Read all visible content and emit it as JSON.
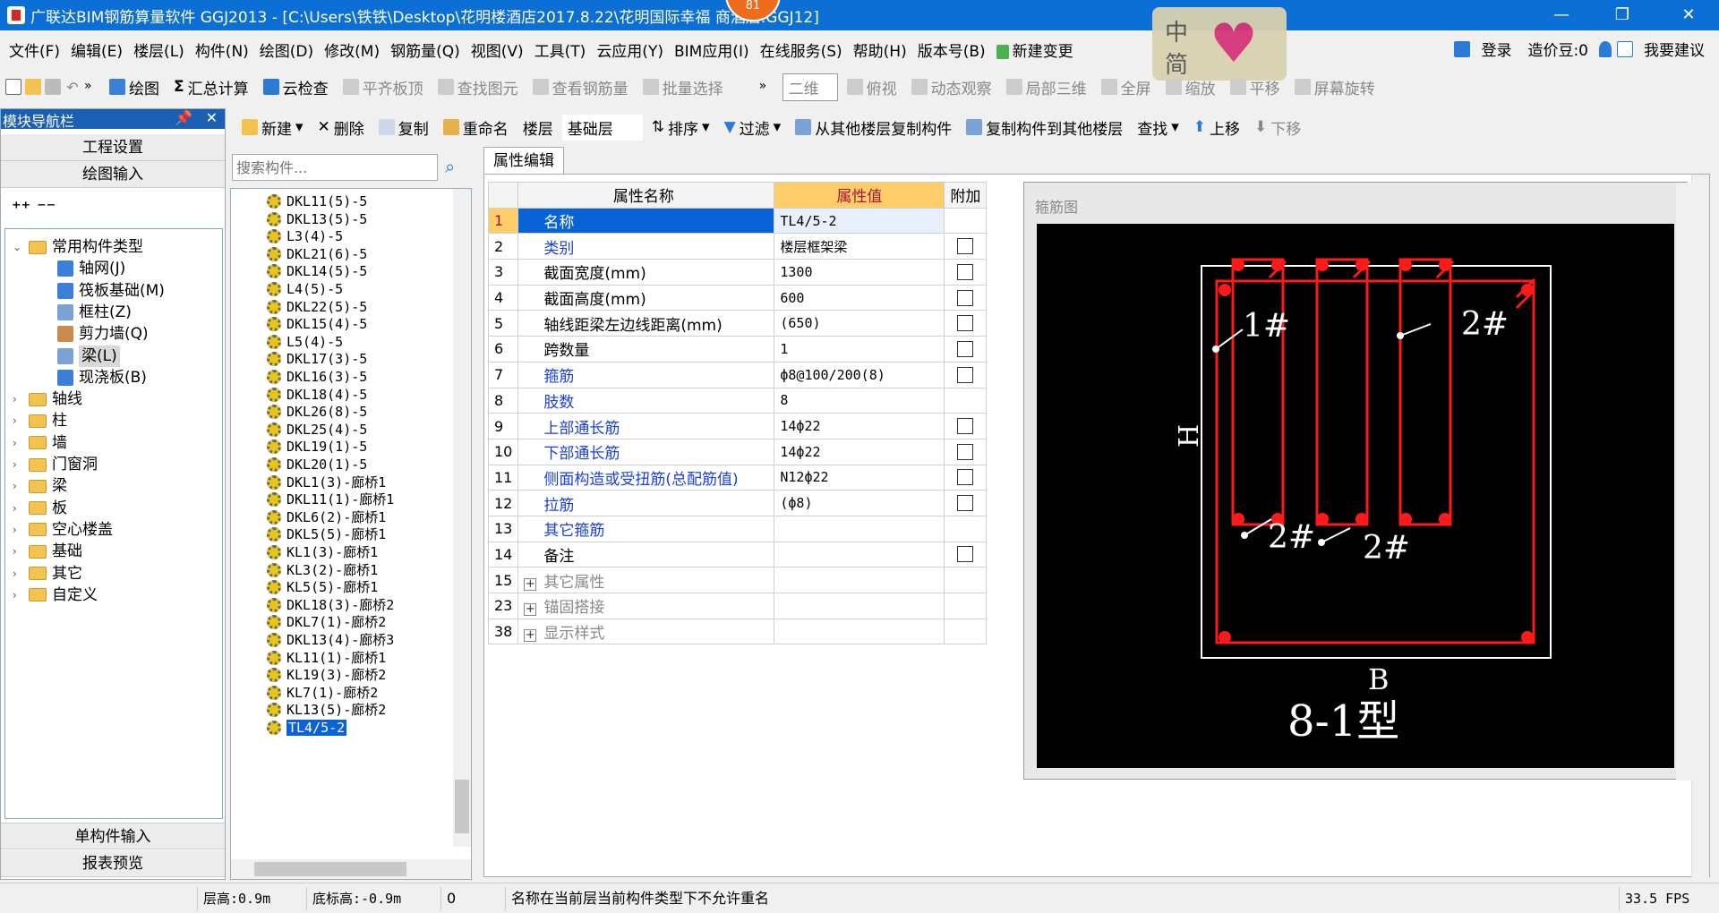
{
  "window": {
    "title": "广联达BIM钢筋算量软件 GGJ2013 - [C:\\Users\\铁铁\\Desktop\\花明楼酒店2017.8.22\\花明国际幸福 商酒店.GGJ12]",
    "badge": "81"
  },
  "menu": [
    "文件(F)",
    "编辑(E)",
    "楼层(L)",
    "构件(N)",
    "绘图(D)",
    "修改(M)",
    "钢筋量(Q)",
    "视图(V)",
    "工具(T)",
    "云应用(Y)",
    "BIM应用(I)",
    "在线服务(S)",
    "帮助(H)",
    "版本号(B)",
    "新建变更"
  ],
  "menu_right": {
    "login": "登录",
    "bean": "造价豆:0",
    "suggest": "我要建议"
  },
  "ime": {
    "zh": "中",
    "jian": "简"
  },
  "toolbar1": [
    "绘图",
    "汇总计算",
    "云检查",
    "平齐板顶",
    "查找图元",
    "查看钢筋量",
    "批量选择",
    "二维",
    "俯视",
    "动态观察",
    "局部三维",
    "全屏",
    "缩放",
    "平移",
    "屏幕旋转"
  ],
  "toolbar2": {
    "new": "新建",
    "delete": "删除",
    "copy": "复制",
    "rename": "重命名",
    "floor_label": "楼层",
    "floor_value": "基础层",
    "sort": "排序",
    "filter": "过滤",
    "copy_from": "从其他楼层复制构件",
    "copy_to": "复制构件到其他楼层",
    "find": "查找",
    "up": "上移",
    "down": "下移"
  },
  "nav": {
    "header": "模块导航栏",
    "project_settings": "工程设置",
    "drawing_input": "绘图输入",
    "single_input": "单构件输入",
    "report": "报表预览",
    "tree": [
      {
        "label": "常用构件类型",
        "level": 0,
        "expanded": true
      },
      {
        "label": "轴网(J)",
        "level": 1
      },
      {
        "label": "筏板基础(M)",
        "level": 1
      },
      {
        "label": "框柱(Z)",
        "level": 1
      },
      {
        "label": "剪力墙(Q)",
        "level": 1
      },
      {
        "label": "梁(L)",
        "level": 1,
        "selected": true
      },
      {
        "label": "现浇板(B)",
        "level": 1
      },
      {
        "label": "轴线",
        "level": 0
      },
      {
        "label": "柱",
        "level": 0
      },
      {
        "label": "墙",
        "level": 0
      },
      {
        "label": "门窗洞",
        "level": 0
      },
      {
        "label": "梁",
        "level": 0
      },
      {
        "label": "板",
        "level": 0
      },
      {
        "label": "空心楼盖",
        "level": 0
      },
      {
        "label": "基础",
        "level": 0
      },
      {
        "label": "其它",
        "level": 0
      },
      {
        "label": "自定义",
        "level": 0
      }
    ]
  },
  "search_placeholder": "搜索构件...",
  "components": [
    "DKL11(5)-5",
    "DKL13(5)-5",
    "L3(4)-5",
    "DKL21(6)-5",
    "DKL14(5)-5",
    "L4(5)-5",
    "DKL22(5)-5",
    "DKL15(4)-5",
    "L5(4)-5",
    "DKL17(3)-5",
    "DKL16(3)-5",
    "DKL18(4)-5",
    "DKL26(8)-5",
    "DKL25(4)-5",
    "DKL19(1)-5",
    "DKL20(1)-5",
    "DKL1(3)-廊桥1",
    "DKL11(1)-廊桥1",
    "DKL6(2)-廊桥1",
    "DKL5(5)-廊桥1",
    "KL1(3)-廊桥1",
    "KL3(2)-廊桥1",
    "KL5(5)-廊桥1",
    "DKL18(3)-廊桥2",
    "DKL7(1)-廊桥2",
    "DKL13(4)-廊桥3",
    "KL11(1)-廊桥1",
    "KL19(3)-廊桥2",
    "KL7(1)-廊桥2",
    "KL13(5)-廊桥2",
    "TL4/5-2"
  ],
  "prop_tab": "属性编辑",
  "prop_headers": [
    "属性名称",
    "属性值",
    "附加"
  ],
  "props": [
    {
      "n": "1",
      "name": "名称",
      "value": "TL4/5-2",
      "blue": true,
      "check": false,
      "sel": true
    },
    {
      "n": "2",
      "name": "类别",
      "value": "楼层框架梁",
      "blue": true,
      "check": true
    },
    {
      "n": "3",
      "name": "截面宽度(mm)",
      "value": "1300",
      "check": true
    },
    {
      "n": "4",
      "name": "截面高度(mm)",
      "value": "600",
      "check": true
    },
    {
      "n": "5",
      "name": "轴线距梁左边线距离(mm)",
      "value": "(650)",
      "check": true
    },
    {
      "n": "6",
      "name": "跨数量",
      "value": "1",
      "check": true
    },
    {
      "n": "7",
      "name": "箍筋",
      "value": "ф8@100/200(8)",
      "blue": true,
      "check": true
    },
    {
      "n": "8",
      "name": "肢数",
      "value": "8",
      "blue": true,
      "check": false
    },
    {
      "n": "9",
      "name": "上部通长筋",
      "value": "14ф22",
      "blue": true,
      "check": true
    },
    {
      "n": "10",
      "name": "下部通长筋",
      "value": "14ф22",
      "blue": true,
      "check": true
    },
    {
      "n": "11",
      "name": "侧面构造或受扭筋(总配筋值)",
      "value": "N12ф22",
      "blue": true,
      "check": true
    },
    {
      "n": "12",
      "name": "拉筋",
      "value": "(ф8)",
      "blue": true,
      "check": true
    },
    {
      "n": "13",
      "name": "其它箍筋",
      "value": "",
      "blue": true,
      "check": false
    },
    {
      "n": "14",
      "name": "备注",
      "value": "",
      "check": true
    },
    {
      "n": "15",
      "name": "其它属性",
      "value": "",
      "grey": true,
      "plus": true,
      "check": false
    },
    {
      "n": "23",
      "name": "锚固搭接",
      "value": "",
      "grey": true,
      "plus": true,
      "check": false
    },
    {
      "n": "38",
      "name": "显示样式",
      "value": "",
      "grey": true,
      "plus": true,
      "check": false
    }
  ],
  "diagram": {
    "caption": "箍筋图",
    "label1": "1#",
    "label2a": "2#",
    "label2b": "2#",
    "label2c": "2#",
    "h": "H",
    "b": "B",
    "type": "8-1型",
    "line_color": "#ff1a1a"
  },
  "status": {
    "floor_height": "层高:0.9m",
    "bottom_height": "底标高:-0.9m",
    "zero": "0",
    "message": "名称在当前层当前构件类型下不允许重名",
    "fps": "33.5 FPS"
  }
}
